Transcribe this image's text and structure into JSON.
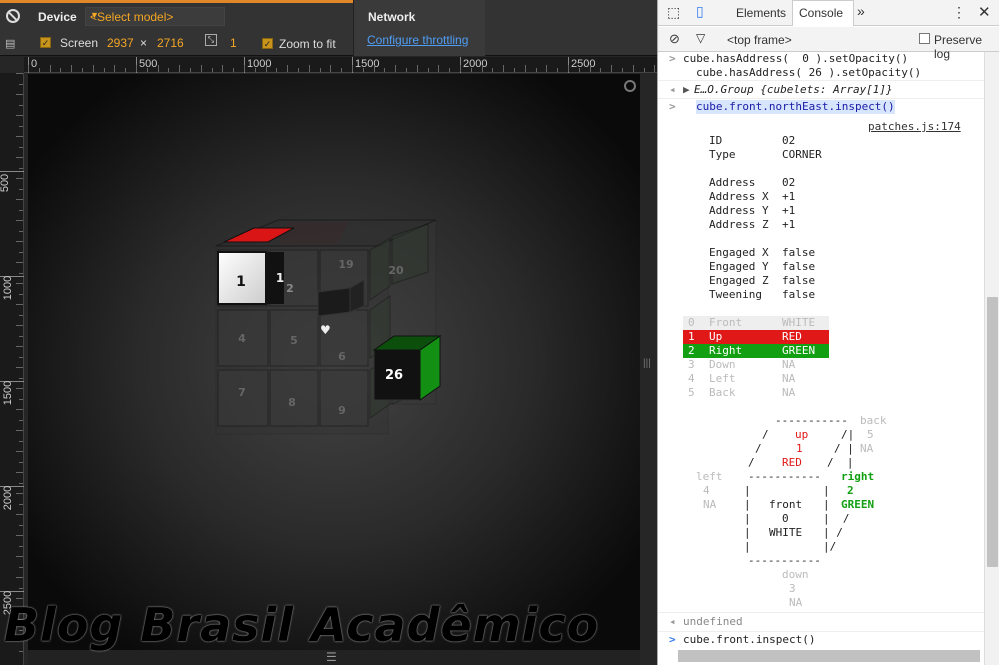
{
  "toolbar": {
    "device_label": "Device",
    "model_select": "<Select model>",
    "screen_label": "Screen",
    "screen_width": "2937",
    "screen_times": "×",
    "screen_height": "2716",
    "pixel_ratio": "1",
    "zoom_label": "Zoom to fit",
    "network_label": "Network",
    "throttling_link": "Configure throttling"
  },
  "ruler": {
    "h_labels": [
      "0",
      "500",
      "1000",
      "1500",
      "2000",
      "2500"
    ],
    "v_labels": [
      "500",
      "1000",
      "1500",
      "2000",
      "2500"
    ]
  },
  "cube": {
    "face_labels": [
      "1",
      "1",
      "2",
      "19",
      "20",
      "26",
      "4",
      "5",
      "6",
      "7",
      "8",
      "9"
    ]
  },
  "watermark": "Blog Brasil Acadêmico",
  "devtools": {
    "tabs": [
      "Elements",
      "Console"
    ],
    "more": "»",
    "context": "<top frame>",
    "preserve_log": "Preserve log",
    "lines": [
      {
        "text": "cube.hasAddress(  0 ).setOpacity()",
        "kind": "input"
      },
      {
        "text": "cube.hasAddress( 26 ).setOpacity()",
        "kind": "cont"
      },
      {
        "text": "E…O.Group {cubelets: Array[1]}",
        "kind": "obj"
      },
      {
        "text": "cube.front.northEast.inspect()",
        "kind": "selected"
      }
    ],
    "source_link": "patches.js:174",
    "props": [
      [
        "ID",
        "02"
      ],
      [
        "Type",
        "CORNER"
      ],
      [
        "",
        ""
      ],
      [
        "Address",
        "02"
      ],
      [
        "Address X",
        "+1"
      ],
      [
        "Address Y",
        "+1"
      ],
      [
        "Address Z",
        "+1"
      ],
      [
        "",
        ""
      ],
      [
        "Engaged X",
        "false"
      ],
      [
        "Engaged Y",
        "false"
      ],
      [
        "Engaged Z",
        "false"
      ],
      [
        "Tweening",
        "false"
      ]
    ],
    "faces": [
      {
        "idx": "0",
        "name": "Front",
        "color": "WHITE",
        "style": "dim"
      },
      {
        "idx": "1",
        "name": "Up",
        "color": "RED",
        "style": "red"
      },
      {
        "idx": "2",
        "name": "Right",
        "color": "GREEN",
        "style": "green"
      },
      {
        "idx": "3",
        "name": "Down",
        "color": "NA",
        "style": "dim"
      },
      {
        "idx": "4",
        "name": "Left",
        "color": "NA",
        "style": "dim"
      },
      {
        "idx": "5",
        "name": "Back",
        "color": "NA",
        "style": "dim"
      }
    ],
    "ascii": {
      "back": "back",
      "back_num": "5",
      "back_na": "NA",
      "up": "up",
      "up_num": "1",
      "up_color": "RED",
      "left": "left",
      "left_num": "4",
      "left_na": "NA",
      "right": "right",
      "right_num": "2",
      "right_color": "GREEN",
      "front": "front",
      "front_num": "0",
      "front_color": "WHITE",
      "down": "down",
      "down_num": "3",
      "down_na": "NA"
    },
    "undefined": "undefined",
    "next_input": "cube.front.inspect()"
  },
  "colors": {
    "red": "#e01818",
    "green": "#12a012",
    "prompt": "#367cf1",
    "selected": "#d7e5fd"
  }
}
